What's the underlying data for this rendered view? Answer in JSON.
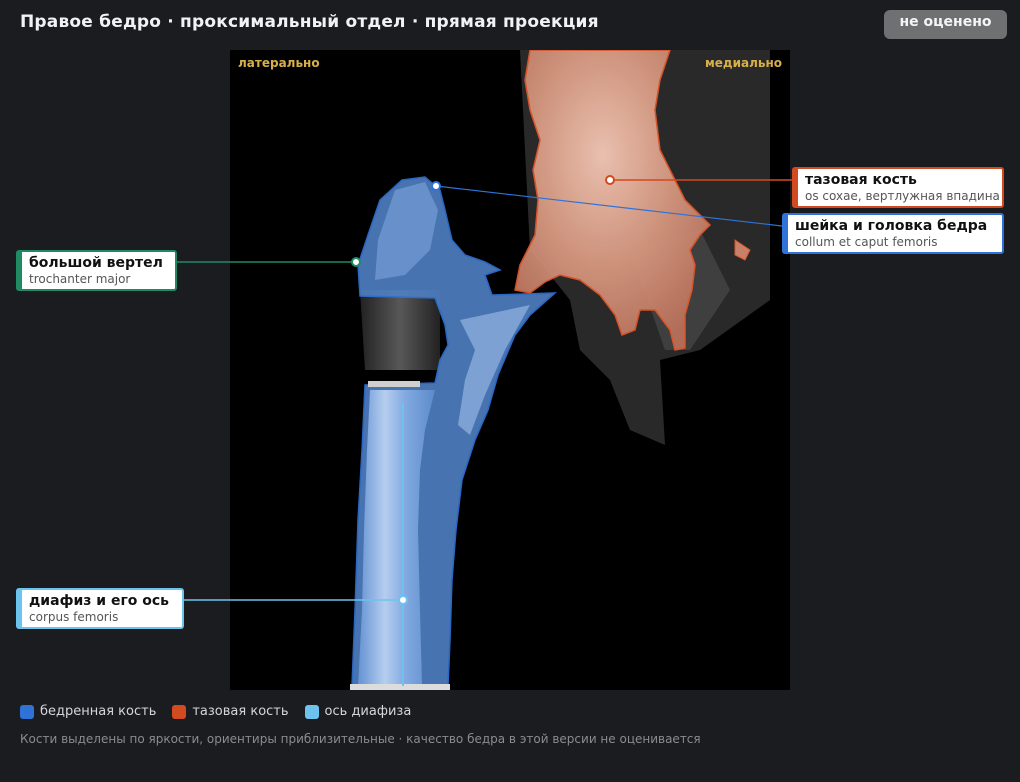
{
  "header": {
    "title": "Правое бедро · проксимальный отдел · прямая проекция",
    "status_badge": "не оценено"
  },
  "image": {
    "orient_left": "латерально",
    "orient_right": "медиально"
  },
  "labels": {
    "trochanter": {
      "main": "большой вертел",
      "sub": "trochanter major",
      "color": "#1f8a63"
    },
    "pelvis": {
      "main": "тазовая кость",
      "sub": "os coxae, вертлужная впадина",
      "color": "#d24a1f"
    },
    "neck": {
      "main": "шейка и головка бедра",
      "sub": "collum et caput femoris",
      "color": "#2f73d8"
    },
    "shaft": {
      "main": "диафиз и его ось",
      "sub": "corpus femoris",
      "color": "#6cc4ee"
    }
  },
  "legend": {
    "femur": {
      "label": "бедренная кость",
      "color": "#2f73d8"
    },
    "pelvis": {
      "label": "тазовая кость",
      "color": "#d24a1f"
    },
    "axis": {
      "label": "ось диафиза",
      "color": "#6cc4ee"
    }
  },
  "footer": "Кости выделены по яркости, ориентиры приблизительные · качество бедра в этой версии не оценивается"
}
